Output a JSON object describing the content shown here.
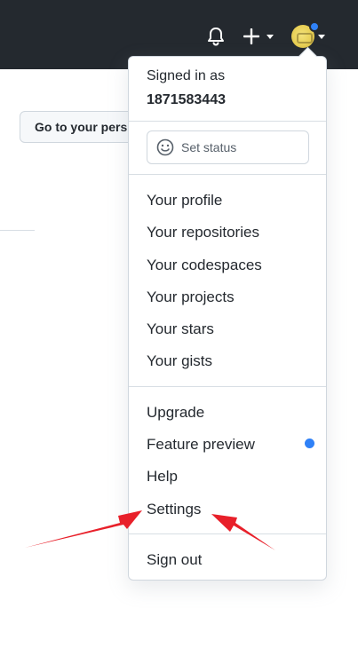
{
  "header": {
    "icons": {
      "bell": "bell-icon",
      "plus": "plus-icon",
      "avatar": "avatar",
      "caret": "caret-down-icon"
    }
  },
  "page": {
    "go_button_label": "Go to your pers"
  },
  "menu": {
    "signed_in_label": "Signed in as",
    "username": "1871583443",
    "set_status_label": "Set status",
    "group1": [
      "Your profile",
      "Your repositories",
      "Your codespaces",
      "Your projects",
      "Your stars",
      "Your gists"
    ],
    "group2": [
      "Upgrade",
      "Feature preview",
      "Help",
      "Settings"
    ],
    "sign_out_label": "Sign out"
  },
  "colors": {
    "header_bg": "#24292f",
    "accent_blue": "#2f81f7",
    "arrow_red": "#e8202a"
  }
}
